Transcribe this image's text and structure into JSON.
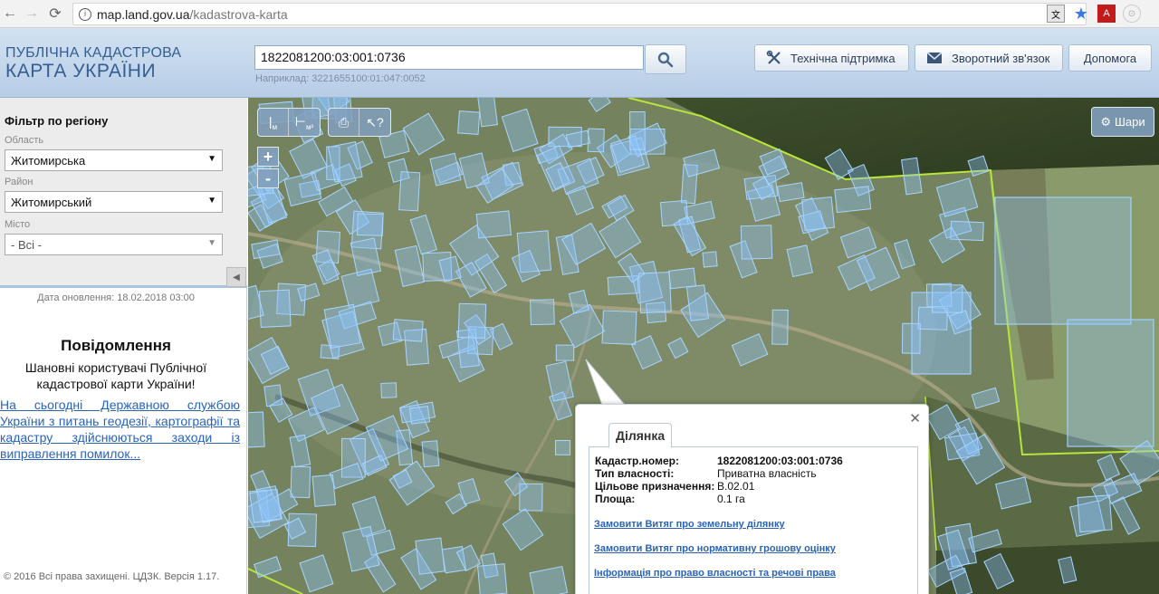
{
  "browser": {
    "url_host": "map.land.gov.ua",
    "url_path": "/kadastrova-karta"
  },
  "header": {
    "logo_line1": "ПУБЛІЧНА КАДАСТРОВА",
    "logo_line2": "КАРТА УКРАЇНИ",
    "search_value": "1822081200:03:001:0736",
    "search_hint": "Наприклад: 3221655100:01:047:0052",
    "buttons": {
      "support": "Технічна підтримка",
      "feedback": "Зворотний зв'язок",
      "help": "Допомога"
    }
  },
  "sidebar": {
    "filter_title": "Фільтр по регіону",
    "oblast_label": "Область",
    "oblast_value": "Житомирська",
    "rayon_label": "Район",
    "rayon_value": "Житомирський",
    "city_label": "Місто",
    "city_value": "- Всі -",
    "update_date": "Дата оновлення: 18.02.2018 03:00",
    "message_title": "Повідомлення",
    "message_sub": "Шановні користувачі Публічної кадастрової карти України!",
    "message_link": "На сьогодні Державною службою України з питань геодезії, картографії та кадастру здійснюються заходи із виправлення помилок...",
    "copyright": "© 2016 Всі права захищені. ЦДЗК. Версія 1.17."
  },
  "map": {
    "layers_label": "Шари",
    "zoom_in": "+",
    "zoom_out": "-"
  },
  "popup": {
    "tab_label": "Ділянка",
    "rows": [
      {
        "key": "Кадастр.номер:",
        "value": "1822081200:03:001:0736"
      },
      {
        "key": "Тип власності:",
        "value": "Приватна власність"
      },
      {
        "key": "Цільове призначення:",
        "value": "В.02.01"
      },
      {
        "key": "Площа:",
        "value": "0.1 га"
      }
    ],
    "links": [
      "Замовити Витяг про земельну ділянку",
      "Замовити Витяг про нормативну грошову оцінку",
      "Інформація про право власності та речові права"
    ]
  },
  "colors": {
    "header_blue": "#c5d8ec",
    "parcel_fill": "#8fc4ff",
    "boundary_green": "#b7e63c"
  }
}
